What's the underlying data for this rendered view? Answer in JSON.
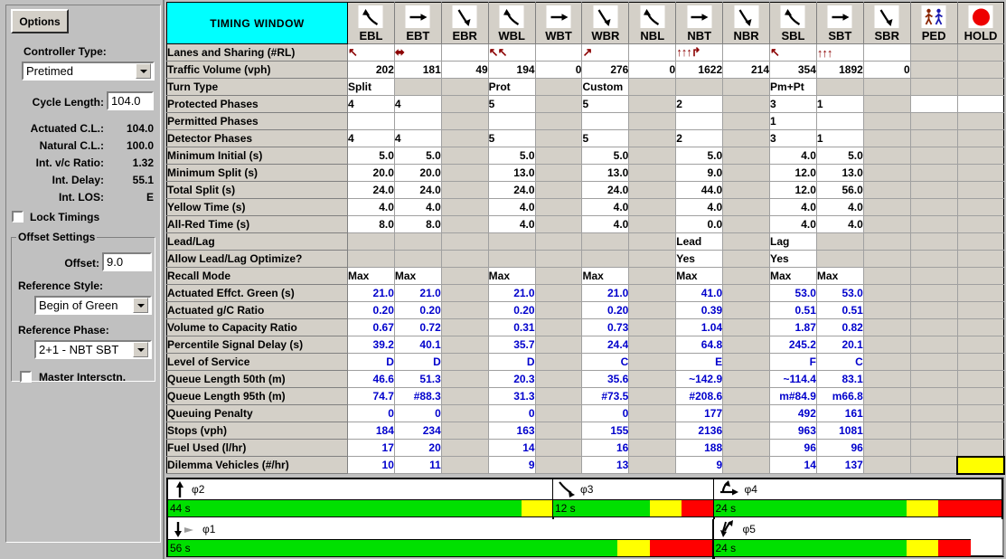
{
  "window": {
    "title": "TIMING WINDOW"
  },
  "sidebar": {
    "options_button": "Options",
    "controller_type_label": "Controller Type:",
    "controller_type_value": "Pretimed",
    "cycle_length_label": "Cycle Length:",
    "cycle_length_value": "104.0",
    "actuated_cl_label": "Actuated C.L.:",
    "actuated_cl_value": "104.0",
    "natural_cl_label": "Natural C.L.:",
    "natural_cl_value": "100.0",
    "int_vc_label": "Int. v/c Ratio:",
    "int_vc_value": "1.32",
    "int_delay_label": "Int. Delay:",
    "int_delay_value": "55.1",
    "int_los_label": "Int. LOS:",
    "int_los_value": "E",
    "lock_timings_label": "Lock Timings",
    "offset_group_label": "Offset Settings",
    "offset_label": "Offset:",
    "offset_value": "9.0",
    "reference_style_label": "Reference Style:",
    "reference_style_value": "Begin of Green",
    "reference_phase_label": "Reference Phase:",
    "reference_phase_value": "2+1 - NBT SBT",
    "master_intersection_label": "Master Intersctn."
  },
  "columns": [
    {
      "name": "EBL",
      "icon": "arrow-left-turn-icon"
    },
    {
      "name": "EBT",
      "icon": "arrow-through-icon"
    },
    {
      "name": "EBR",
      "icon": "arrow-right-turn-icon"
    },
    {
      "name": "WBL",
      "icon": "arrow-left-turn-icon"
    },
    {
      "name": "WBT",
      "icon": "arrow-through-icon"
    },
    {
      "name": "WBR",
      "icon": "arrow-right-turn-icon"
    },
    {
      "name": "NBL",
      "icon": "arrow-left-turn-icon"
    },
    {
      "name": "NBT",
      "icon": "arrow-through-icon"
    },
    {
      "name": "NBR",
      "icon": "arrow-right-turn-icon"
    },
    {
      "name": "SBL",
      "icon": "arrow-left-turn-icon"
    },
    {
      "name": "SBT",
      "icon": "arrow-through-icon"
    },
    {
      "name": "SBR",
      "icon": "arrow-right-turn-icon"
    },
    {
      "name": "PED",
      "icon": "pedestrian-icon"
    },
    {
      "name": "HOLD",
      "icon": "red-circle-icon"
    }
  ],
  "rows": [
    {
      "label": "Lanes and Sharing (#RL)",
      "style": "lanes",
      "values": [
        "↖",
        "⬌",
        "",
        "↖↖",
        "",
        "↗",
        "",
        "↑↑↑↱",
        "",
        "↖",
        "↑↑↑",
        "",
        null,
        null
      ]
    },
    {
      "label": "Traffic Volume (vph)",
      "style": "num",
      "values": [
        "202",
        "181",
        "49",
        "194",
        "0",
        "276",
        "0",
        "1622",
        "214",
        "354",
        "1892",
        "0",
        null,
        null
      ]
    },
    {
      "label": "Turn Type",
      "style": "txt",
      "values": [
        "Split",
        null,
        null,
        "Prot",
        null,
        "Custom",
        null,
        null,
        null,
        "Pm+Pt",
        null,
        null,
        null,
        null
      ]
    },
    {
      "label": "Protected Phases",
      "style": "txt",
      "values": [
        "4",
        "4",
        null,
        "5",
        null,
        "5",
        null,
        "2",
        null,
        "3",
        "1",
        null,
        "",
        ""
      ]
    },
    {
      "label": "Permitted Phases",
      "style": "txt",
      "values": [
        "",
        "",
        null,
        "",
        null,
        "",
        null,
        "",
        null,
        "1",
        "",
        null,
        null,
        null
      ]
    },
    {
      "label": "Detector Phases",
      "style": "txt",
      "values": [
        "4",
        "4",
        null,
        "5",
        null,
        "5",
        null,
        "2",
        null,
        "3",
        "1",
        null,
        null,
        null
      ]
    },
    {
      "label": "Minimum Initial (s)",
      "style": "num",
      "values": [
        "5.0",
        "5.0",
        null,
        "5.0",
        null,
        "5.0",
        null,
        "5.0",
        null,
        "4.0",
        "5.0",
        null,
        null,
        null
      ]
    },
    {
      "label": "Minimum Split (s)",
      "style": "num",
      "values": [
        "20.0",
        "20.0",
        null,
        "13.0",
        null,
        "13.0",
        null,
        "9.0",
        null,
        "12.0",
        "13.0",
        null,
        null,
        null
      ]
    },
    {
      "label": "Total Split (s)",
      "style": "num",
      "values": [
        "24.0",
        "24.0",
        null,
        "24.0",
        null,
        "24.0",
        null,
        "44.0",
        null,
        "12.0",
        "56.0",
        null,
        null,
        null
      ]
    },
    {
      "label": "Yellow Time (s)",
      "style": "num",
      "values": [
        "4.0",
        "4.0",
        null,
        "4.0",
        null,
        "4.0",
        null,
        "4.0",
        null,
        "4.0",
        "4.0",
        null,
        null,
        null
      ]
    },
    {
      "label": "All-Red Time (s)",
      "style": "num",
      "values": [
        "8.0",
        "8.0",
        null,
        "4.0",
        null,
        "4.0",
        null,
        "0.0",
        null,
        "4.0",
        "4.0",
        null,
        null,
        null
      ]
    },
    {
      "label": "Lead/Lag",
      "style": "txt",
      "values": [
        null,
        null,
        null,
        null,
        null,
        null,
        null,
        "Lead",
        null,
        "Lag",
        null,
        null,
        null,
        null
      ]
    },
    {
      "label": "Allow Lead/Lag Optimize?",
      "style": "txt",
      "values": [
        null,
        null,
        null,
        null,
        null,
        null,
        null,
        "Yes",
        null,
        "Yes",
        null,
        null,
        null,
        null
      ]
    },
    {
      "label": "Recall Mode",
      "style": "txt",
      "values": [
        "Max",
        "Max",
        null,
        "Max",
        null,
        "Max",
        null,
        "Max",
        null,
        "Max",
        "Max",
        null,
        null,
        null
      ]
    },
    {
      "label": "Actuated Effct. Green (s)",
      "style": "blue",
      "values": [
        "21.0",
        "21.0",
        null,
        "21.0",
        null,
        "21.0",
        null,
        "41.0",
        null,
        "53.0",
        "53.0",
        null,
        null,
        null
      ]
    },
    {
      "label": "Actuated g/C Ratio",
      "style": "blue",
      "values": [
        "0.20",
        "0.20",
        null,
        "0.20",
        null,
        "0.20",
        null,
        "0.39",
        null,
        "0.51",
        "0.51",
        null,
        null,
        null
      ]
    },
    {
      "label": "Volume to Capacity Ratio",
      "style": "blue",
      "values": [
        "0.67",
        "0.72",
        null,
        "0.31",
        null,
        "0.73",
        null,
        "1.04",
        null,
        "1.87",
        "0.82",
        null,
        null,
        null
      ]
    },
    {
      "label": "Percentile Signal Delay (s)",
      "style": "blue",
      "values": [
        "39.2",
        "40.1",
        null,
        "35.7",
        null,
        "24.4",
        null,
        "64.8",
        null,
        "245.2",
        "20.1",
        null,
        null,
        null
      ]
    },
    {
      "label": "Level of Service",
      "style": "blue",
      "values": [
        "D",
        "D",
        null,
        "D",
        null,
        "C",
        null,
        "E",
        null,
        "F",
        "C",
        null,
        null,
        null
      ]
    },
    {
      "label": "Queue Length 50th (m)",
      "style": "blue",
      "values": [
        "46.6",
        "51.3",
        null,
        "20.3",
        null,
        "35.6",
        null,
        "~142.9",
        null,
        "~114.4",
        "83.1",
        null,
        null,
        null
      ]
    },
    {
      "label": "Queue Length 95th (m)",
      "style": "blue",
      "values": [
        "74.7",
        "#88.3",
        null,
        "31.3",
        null,
        "#73.5",
        null,
        "#208.6",
        null,
        "m#84.9",
        "m66.8",
        null,
        null,
        null
      ]
    },
    {
      "label": "Queuing Penalty",
      "style": "blue",
      "values": [
        "0",
        "0",
        null,
        "0",
        null,
        "0",
        null,
        "177",
        null,
        "492",
        "161",
        null,
        null,
        null
      ]
    },
    {
      "label": "Stops (vph)",
      "style": "blue",
      "values": [
        "184",
        "234",
        null,
        "163",
        null,
        "155",
        null,
        "2136",
        null,
        "963",
        "1081",
        null,
        null,
        null
      ]
    },
    {
      "label": "Fuel Used (l/hr)",
      "style": "blue",
      "values": [
        "17",
        "20",
        null,
        "14",
        null,
        "16",
        null,
        "188",
        null,
        "96",
        "96",
        null,
        null,
        null
      ]
    },
    {
      "label": "Dilemma Vehicles (#/hr)",
      "style": "blue",
      "values": [
        "10",
        "11",
        null,
        "9",
        null,
        "13",
        null,
        "9",
        null,
        "14",
        "137",
        null,
        null,
        "HIGHLIGHT"
      ]
    }
  ],
  "phase_diagram": {
    "cycle_length": 104,
    "colors": {
      "green": "#00e000",
      "yellow": "#ffff00",
      "red": "#ff0000"
    },
    "rings": [
      {
        "phases": [
          {
            "name": "φ2",
            "icon": "arrow-up-icon",
            "duration_label": "44 s",
            "green": 44,
            "yellow": 4,
            "red": 0,
            "total": 48
          },
          {
            "name": "φ3",
            "icon": "arrow-down-right-icon",
            "duration_label": "12 s",
            "green": 12,
            "yellow": 4,
            "red": 4,
            "total": 20
          },
          {
            "name": "φ4",
            "icon": "arrow-split-left-icon",
            "duration_label": "24 s",
            "green": 24,
            "yellow": 4,
            "red": 8,
            "total": 36
          }
        ]
      },
      {
        "phases": [
          {
            "name": "φ1",
            "icon": "arrow-down-perm-icon",
            "duration_label": "56 s",
            "green": 56,
            "yellow": 4,
            "red": 8,
            "total": 68
          }
        ]
      },
      {
        "phases": [
          {
            "name": "φ5",
            "icon": "arrow-split-down-icon",
            "duration_label": "24 s",
            "green": 24,
            "yellow": 4,
            "red": 4,
            "total": 32
          }
        ]
      }
    ]
  }
}
